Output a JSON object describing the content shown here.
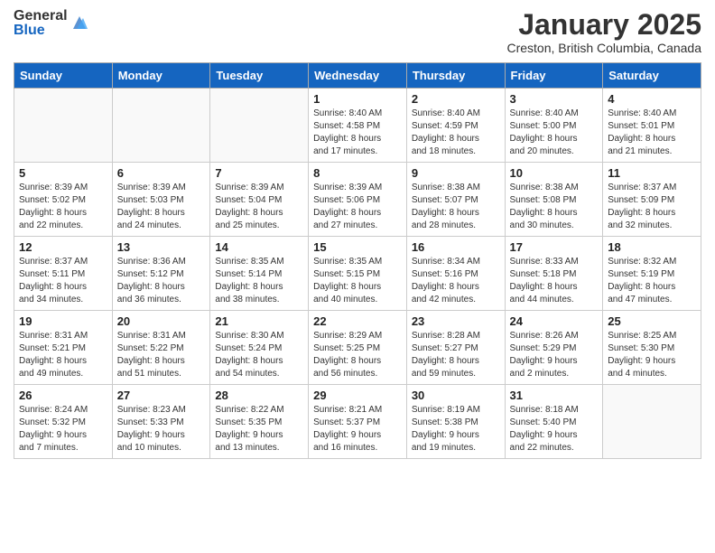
{
  "header": {
    "logo_general": "General",
    "logo_blue": "Blue",
    "title": "January 2025",
    "subtitle": "Creston, British Columbia, Canada"
  },
  "weekdays": [
    "Sunday",
    "Monday",
    "Tuesday",
    "Wednesday",
    "Thursday",
    "Friday",
    "Saturday"
  ],
  "weeks": [
    {
      "days": [
        {
          "num": "",
          "info": ""
        },
        {
          "num": "",
          "info": ""
        },
        {
          "num": "",
          "info": ""
        },
        {
          "num": "1",
          "info": "Sunrise: 8:40 AM\nSunset: 4:58 PM\nDaylight: 8 hours\nand 17 minutes."
        },
        {
          "num": "2",
          "info": "Sunrise: 8:40 AM\nSunset: 4:59 PM\nDaylight: 8 hours\nand 18 minutes."
        },
        {
          "num": "3",
          "info": "Sunrise: 8:40 AM\nSunset: 5:00 PM\nDaylight: 8 hours\nand 20 minutes."
        },
        {
          "num": "4",
          "info": "Sunrise: 8:40 AM\nSunset: 5:01 PM\nDaylight: 8 hours\nand 21 minutes."
        }
      ]
    },
    {
      "days": [
        {
          "num": "5",
          "info": "Sunrise: 8:39 AM\nSunset: 5:02 PM\nDaylight: 8 hours\nand 22 minutes."
        },
        {
          "num": "6",
          "info": "Sunrise: 8:39 AM\nSunset: 5:03 PM\nDaylight: 8 hours\nand 24 minutes."
        },
        {
          "num": "7",
          "info": "Sunrise: 8:39 AM\nSunset: 5:04 PM\nDaylight: 8 hours\nand 25 minutes."
        },
        {
          "num": "8",
          "info": "Sunrise: 8:39 AM\nSunset: 5:06 PM\nDaylight: 8 hours\nand 27 minutes."
        },
        {
          "num": "9",
          "info": "Sunrise: 8:38 AM\nSunset: 5:07 PM\nDaylight: 8 hours\nand 28 minutes."
        },
        {
          "num": "10",
          "info": "Sunrise: 8:38 AM\nSunset: 5:08 PM\nDaylight: 8 hours\nand 30 minutes."
        },
        {
          "num": "11",
          "info": "Sunrise: 8:37 AM\nSunset: 5:09 PM\nDaylight: 8 hours\nand 32 minutes."
        }
      ]
    },
    {
      "days": [
        {
          "num": "12",
          "info": "Sunrise: 8:37 AM\nSunset: 5:11 PM\nDaylight: 8 hours\nand 34 minutes."
        },
        {
          "num": "13",
          "info": "Sunrise: 8:36 AM\nSunset: 5:12 PM\nDaylight: 8 hours\nand 36 minutes."
        },
        {
          "num": "14",
          "info": "Sunrise: 8:35 AM\nSunset: 5:14 PM\nDaylight: 8 hours\nand 38 minutes."
        },
        {
          "num": "15",
          "info": "Sunrise: 8:35 AM\nSunset: 5:15 PM\nDaylight: 8 hours\nand 40 minutes."
        },
        {
          "num": "16",
          "info": "Sunrise: 8:34 AM\nSunset: 5:16 PM\nDaylight: 8 hours\nand 42 minutes."
        },
        {
          "num": "17",
          "info": "Sunrise: 8:33 AM\nSunset: 5:18 PM\nDaylight: 8 hours\nand 44 minutes."
        },
        {
          "num": "18",
          "info": "Sunrise: 8:32 AM\nSunset: 5:19 PM\nDaylight: 8 hours\nand 47 minutes."
        }
      ]
    },
    {
      "days": [
        {
          "num": "19",
          "info": "Sunrise: 8:31 AM\nSunset: 5:21 PM\nDaylight: 8 hours\nand 49 minutes."
        },
        {
          "num": "20",
          "info": "Sunrise: 8:31 AM\nSunset: 5:22 PM\nDaylight: 8 hours\nand 51 minutes."
        },
        {
          "num": "21",
          "info": "Sunrise: 8:30 AM\nSunset: 5:24 PM\nDaylight: 8 hours\nand 54 minutes."
        },
        {
          "num": "22",
          "info": "Sunrise: 8:29 AM\nSunset: 5:25 PM\nDaylight: 8 hours\nand 56 minutes."
        },
        {
          "num": "23",
          "info": "Sunrise: 8:28 AM\nSunset: 5:27 PM\nDaylight: 8 hours\nand 59 minutes."
        },
        {
          "num": "24",
          "info": "Sunrise: 8:26 AM\nSunset: 5:29 PM\nDaylight: 9 hours\nand 2 minutes."
        },
        {
          "num": "25",
          "info": "Sunrise: 8:25 AM\nSunset: 5:30 PM\nDaylight: 9 hours\nand 4 minutes."
        }
      ]
    },
    {
      "days": [
        {
          "num": "26",
          "info": "Sunrise: 8:24 AM\nSunset: 5:32 PM\nDaylight: 9 hours\nand 7 minutes."
        },
        {
          "num": "27",
          "info": "Sunrise: 8:23 AM\nSunset: 5:33 PM\nDaylight: 9 hours\nand 10 minutes."
        },
        {
          "num": "28",
          "info": "Sunrise: 8:22 AM\nSunset: 5:35 PM\nDaylight: 9 hours\nand 13 minutes."
        },
        {
          "num": "29",
          "info": "Sunrise: 8:21 AM\nSunset: 5:37 PM\nDaylight: 9 hours\nand 16 minutes."
        },
        {
          "num": "30",
          "info": "Sunrise: 8:19 AM\nSunset: 5:38 PM\nDaylight: 9 hours\nand 19 minutes."
        },
        {
          "num": "31",
          "info": "Sunrise: 8:18 AM\nSunset: 5:40 PM\nDaylight: 9 hours\nand 22 minutes."
        },
        {
          "num": "",
          "info": ""
        }
      ]
    }
  ]
}
